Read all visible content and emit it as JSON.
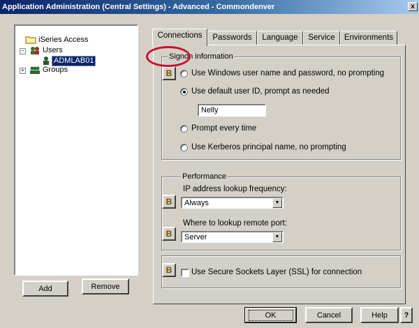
{
  "window": {
    "title": "Application Administration (Central Settings) - Advanced - Commondenver",
    "close_label": "x"
  },
  "tree": {
    "root": "iSeries Access",
    "users": "Users",
    "selected_user": "ADMLAB01",
    "groups": "Groups"
  },
  "left_buttons": {
    "add": "Add",
    "remove": "Remove"
  },
  "tabs": [
    {
      "label": "Connections",
      "active": true
    },
    {
      "label": "Passwords",
      "active": false
    },
    {
      "label": "Language",
      "active": false
    },
    {
      "label": "Service",
      "active": false
    },
    {
      "label": "Environments",
      "active": false
    }
  ],
  "signon": {
    "legend": "Signon information",
    "options": [
      "Use Windows user name and password, no prompting",
      "Use default user ID, prompt as needed",
      "Prompt every time",
      "Use Kerberos principal name, no prompting"
    ],
    "selected_index": 1,
    "default_user_id": "Nelly"
  },
  "performance": {
    "legend": "Performance",
    "ip_label": "IP address lookup frequency:",
    "ip_value": "Always",
    "port_label": "Where to lookup remote port:",
    "port_value": "Server"
  },
  "ssl": {
    "label": "Use Secure Sockets Layer (SSL) for connection",
    "checked": false
  },
  "footer": {
    "ok": "OK",
    "cancel": "Cancel",
    "help": "Help",
    "question": "?"
  },
  "colors": {
    "annotation_circle": "#c8102e",
    "selection": "#0a246a"
  },
  "icons": {
    "lock": "lock-icon",
    "folder": "folder-icon",
    "users": "users-icon",
    "user": "user-icon",
    "groups": "groups-icon"
  }
}
